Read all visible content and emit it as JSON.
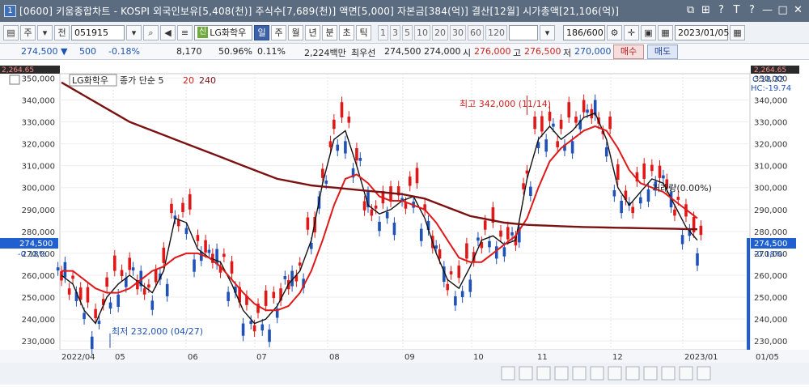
{
  "titlebar": {
    "badge": "1",
    "text": "[0600] 키움종합차트 - KOSPI 외국인보유[5,408(천)] 주식수[7,689(천)] 액면[5,000] 자본금[384(억)] 결산[12월] 시가총액[21,106(억)]",
    "icons": [
      "window-icon",
      "copy-icon",
      "question-icon",
      "text-icon",
      "help-icon",
      "minimize-icon",
      "maximize-icon",
      "close-icon"
    ],
    "icon_glyphs": [
      "⧉",
      "⊞",
      "?",
      "T",
      "?",
      "—",
      "□",
      "✕"
    ]
  },
  "toolbar": {
    "market": "주",
    "all": "전",
    "code": "051915",
    "stock_tag": "신",
    "stock_name": "LG화학우",
    "periods": [
      "일",
      "주",
      "월",
      "년",
      "분",
      "초",
      "틱"
    ],
    "active_period": 0,
    "numbers": [
      "1",
      "3",
      "5",
      "10",
      "20",
      "30",
      "60",
      "120"
    ],
    "count": "186/600",
    "date": "2023/01/05"
  },
  "quote": {
    "price": "274,500",
    "change": "500",
    "rate": "-0.18%",
    "volume": "8,170",
    "turnover": "50.96%",
    "foreign": "0.11%",
    "amount": "2,224백만",
    "best_label": "최우선",
    "best_ask": "274,500",
    "best_bid": "274,000",
    "open_label": "시",
    "open": "276,000",
    "high_label": "고",
    "high": "276,500",
    "low_label": "저",
    "low": "270,000",
    "buy": "매수",
    "sell": "매도"
  },
  "chart_header": {
    "stock_name": "LG화학우",
    "indicator": "종가 단순 5",
    "ma2": "20",
    "ma3": "240",
    "crosshair": "C:18.32",
    "hc": "HC:-19.74",
    "max_label": "최고 342,000 (11/14)",
    "min_label": "최저 232,000 (04/27)",
    "current_price": "274,500",
    "current_rate": "-0.18%",
    "annotation": "거래량(0.00%)",
    "kospi_overlay": "2,264.65",
    "kospi_overlay_right": "2,264.65"
  },
  "chart_data": {
    "type": "line",
    "title": "",
    "xlabel": "",
    "ylabel": "",
    "ylim": [
      226000,
      352000
    ],
    "yticks": [
      350000,
      340000,
      330000,
      320000,
      310000,
      300000,
      290000,
      280000,
      270000,
      260000,
      250000,
      240000,
      230000
    ],
    "ytick_labels": [
      "350,000",
      "340,000",
      "330,000",
      "320,000",
      "310,000",
      "300,000",
      "290,000",
      "280,000",
      "270,000",
      "260,000",
      "250,000",
      "240,000",
      "230,000"
    ],
    "months": [
      "2022/04",
      "05",
      "06",
      "07",
      "08",
      "09",
      "10",
      "11",
      "12",
      "2023/01",
      "01/05"
    ],
    "series": [
      {
        "name": "5",
        "color": "#111111",
        "values": [
          260000,
          256000,
          244000,
          238000,
          250000,
          256000,
          260000,
          256000,
          252000,
          262000,
          286000,
          284000,
          272000,
          268000,
          266000,
          256000,
          244000,
          238000,
          240000,
          246000,
          256000,
          262000,
          276000,
          302000,
          322000,
          326000,
          310000,
          292000,
          288000,
          290000,
          294000,
          296000,
          286000,
          270000,
          258000,
          254000,
          264000,
          276000,
          278000,
          274000,
          276000,
          304000,
          322000,
          328000,
          322000,
          326000,
          332000,
          334000,
          322000,
          300000,
          292000,
          298000,
          304000,
          302000,
          292000,
          282000,
          276000
        ]
      },
      {
        "name": "20",
        "color": "#e01818",
        "values": [
          262000,
          262000,
          258000,
          254000,
          252000,
          252000,
          254000,
          258000,
          262000,
          264000,
          268000,
          270000,
          270000,
          268000,
          264000,
          258000,
          252000,
          247000,
          244000,
          244000,
          246000,
          252000,
          262000,
          276000,
          292000,
          304000,
          306000,
          302000,
          296000,
          294000,
          294000,
          292000,
          290000,
          284000,
          276000,
          268000,
          266000,
          266000,
          270000,
          274000,
          278000,
          286000,
          300000,
          312000,
          318000,
          322000,
          326000,
          328000,
          326000,
          318000,
          308000,
          302000,
          300000,
          298000,
          294000,
          290000,
          286000
        ]
      },
      {
        "name": "240",
        "color": "#7a1212",
        "values": [
          348000,
          345000,
          342000,
          339000,
          336000,
          333000,
          330000,
          328000,
          326000,
          324000,
          322000,
          320000,
          318000,
          316000,
          314000,
          312000,
          310000,
          308000,
          306000,
          304000,
          303000,
          302000,
          301000,
          300500,
          300000,
          299500,
          299000,
          298500,
          298000,
          297500,
          297000,
          296000,
          295000,
          293000,
          291000,
          289000,
          287000,
          286000,
          285000,
          284000,
          283500,
          283000,
          282800,
          282600,
          282400,
          282200,
          282000,
          281900,
          281800,
          281700,
          281600,
          281500,
          281400,
          281300,
          281200,
          281100,
          281000
        ]
      }
    ],
    "max": {
      "value": 342000,
      "date": "11/14"
    },
    "min": {
      "value": 232000,
      "date": "04/27"
    },
    "legend": "top-left",
    "grid": true
  }
}
